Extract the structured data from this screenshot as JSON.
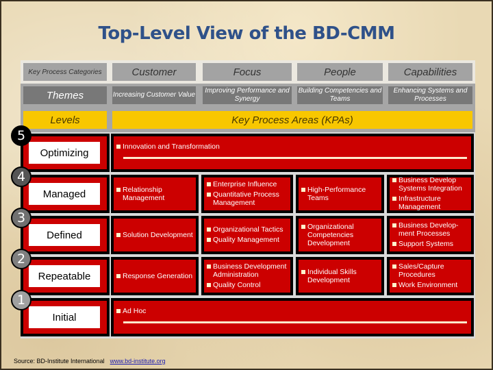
{
  "title": "Top-Level View of the BD-CMM",
  "header": {
    "categories_label": "Key Process Categories",
    "categories": [
      "Customer",
      "Focus",
      "People",
      "Capabilities"
    ],
    "themes_label": "Themes",
    "themes": [
      "Increasing Customer Value",
      "Improving Performance and Synergy",
      "Building Competencies and Teams",
      "Enhancing Systems and Processes"
    ],
    "levels_label": "Levels",
    "kpas_label": "Key Process Areas (KPAs)"
  },
  "levels": [
    {
      "number": "5",
      "name": "Optimizing",
      "badge_color": "#000000",
      "span_item": "Innovation and Transformation"
    },
    {
      "number": "4",
      "name": "Managed",
      "badge_color": "#555555",
      "cells": [
        [
          "Relationship Management"
        ],
        [
          "Enterprise Influence",
          "Quantitative Process Management"
        ],
        [
          "High-Performance Teams"
        ],
        [
          "Business Develop Systems Integration",
          "Infrastructure Management"
        ]
      ]
    },
    {
      "number": "3",
      "name": "Defined",
      "badge_color": "#707070",
      "cells": [
        [
          "Solution  Development"
        ],
        [
          "Organizational Tactics",
          "Quality Management"
        ],
        [
          "Organizational Competencies Development"
        ],
        [
          "Business Develop-ment Processes",
          "Support Systems"
        ]
      ]
    },
    {
      "number": "2",
      "name": "Repeatable",
      "badge_color": "#808080",
      "cells": [
        [
          "Response Generation"
        ],
        [
          "Business Development Administration",
          "Quality Control"
        ],
        [
          "Individual Skills Development"
        ],
        [
          "Sales/Capture Procedures",
          "Work Environment"
        ]
      ]
    },
    {
      "number": "1",
      "name": "Initial",
      "badge_color": "#a0a0a0",
      "span_item": "Ad Hoc"
    }
  ],
  "source": {
    "text": "Source: BD-Institute International",
    "link": "www.bd-institute.org"
  },
  "colors": {
    "title": "#2f5189",
    "kpa_red": "#cc0000",
    "levels_yellow": "#f8c700"
  }
}
